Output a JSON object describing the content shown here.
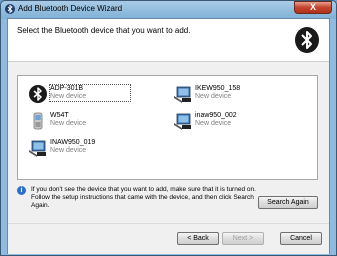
{
  "window": {
    "title": "Add Bluetooth Device Wizard",
    "close_label": "X"
  },
  "header": {
    "title": "Select the Bluetooth device that you want to add."
  },
  "devices": [
    {
      "name": "ADP-301B",
      "status": "New device",
      "icon": "bluetooth-icon",
      "selected": true
    },
    {
      "name": "IKEW950_158",
      "status": "New device",
      "icon": "computer-icon",
      "selected": false
    },
    {
      "name": "W54T",
      "status": "New device",
      "icon": "phone-icon",
      "selected": false
    },
    {
      "name": "inaw950_002",
      "status": "New device",
      "icon": "computer-icon",
      "selected": false
    },
    {
      "name": "INAW950_019",
      "status": "New device",
      "icon": "computer-icon",
      "selected": false
    }
  ],
  "info": {
    "text": "If you don't see the device that you want to add, make sure that it is turned on. Follow the setup instructions that came with the device, and then click Search Again."
  },
  "buttons": {
    "search_again": "Search Again",
    "back": "< Back",
    "next": "Next >",
    "cancel": "Cancel"
  },
  "colors": {
    "titlebar": "#7fb0d6",
    "close": "#c4442c",
    "bluetooth_bg": "#1a1a1a",
    "info_icon": "#2f6fc9"
  }
}
